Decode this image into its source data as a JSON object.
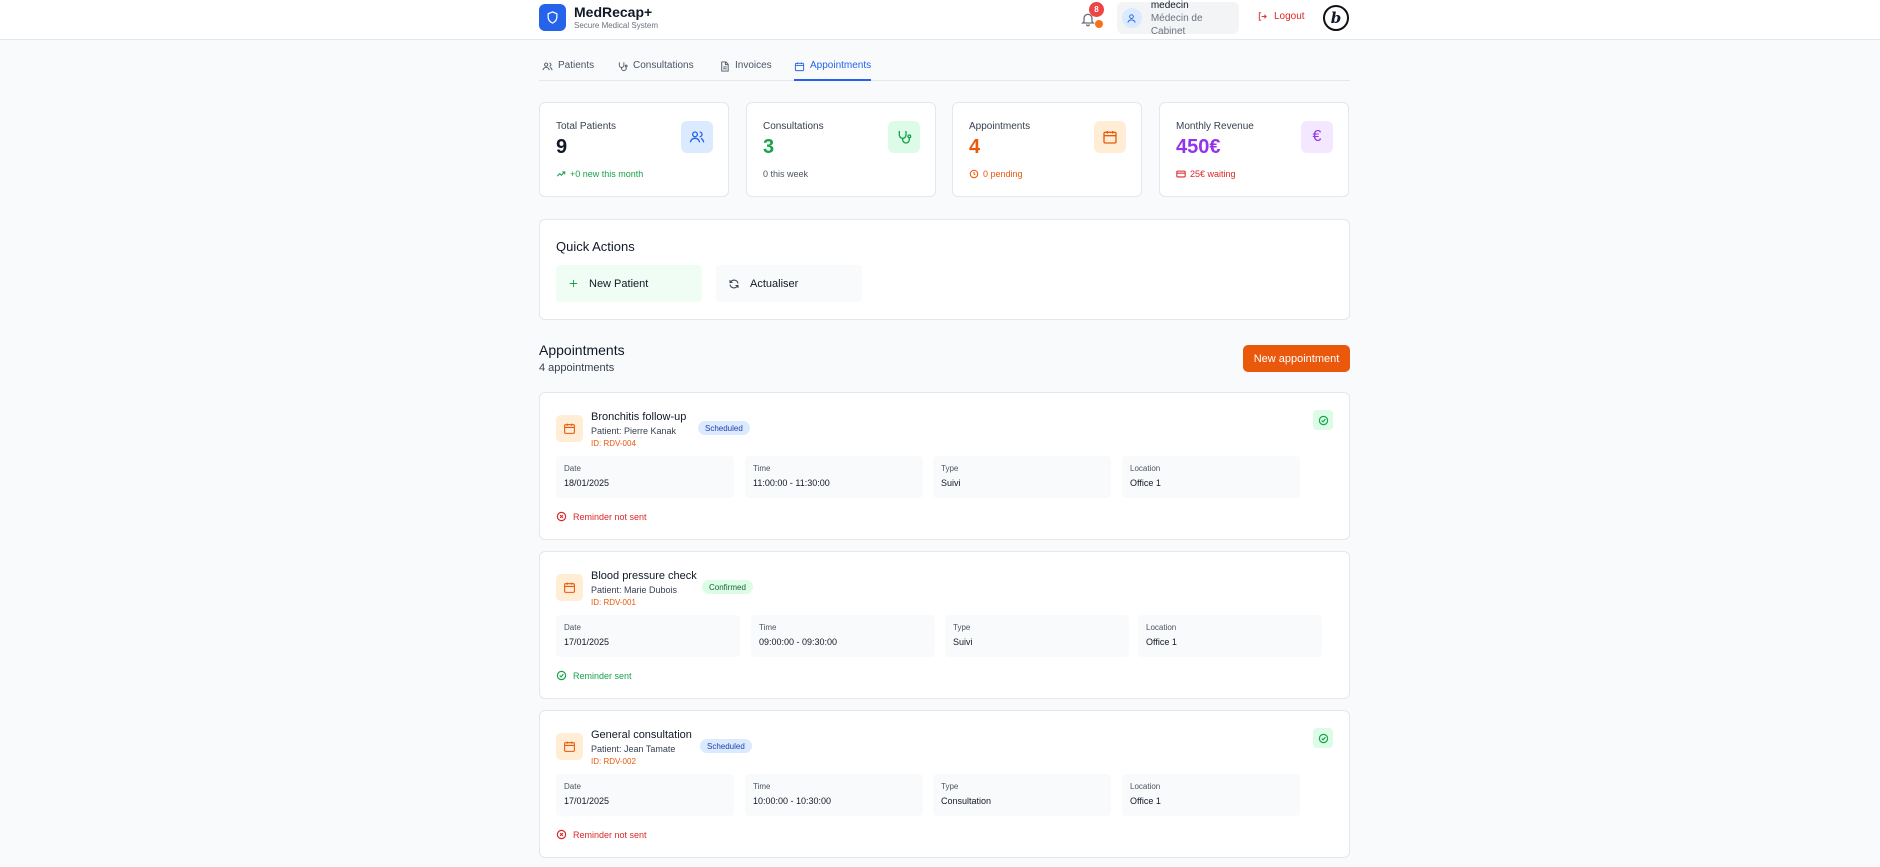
{
  "app": {
    "name": "MedRecap+",
    "tagline": "Secure Medical System"
  },
  "header": {
    "notifications_count": "8",
    "user": {
      "name": "medecin",
      "role": "Médecin de Cabinet"
    },
    "logout_label": "Logout"
  },
  "tabs": [
    {
      "label": "Patients",
      "icon": "users-icon",
      "active": false
    },
    {
      "label": "Consultations",
      "icon": "stethoscope-icon",
      "active": false
    },
    {
      "label": "Invoices",
      "icon": "file-icon",
      "active": false
    },
    {
      "label": "Appointments",
      "icon": "calendar-icon",
      "active": true
    }
  ],
  "stats": [
    {
      "label": "Total Patients",
      "value": "9",
      "sub": "+0 new this month",
      "color": "#111827",
      "sub_color": "#16a34a",
      "icon": "users-icon"
    },
    {
      "label": "Consultations",
      "value": "3",
      "sub": "0 this week",
      "color": "#16a34a",
      "sub_color": "#4b5563",
      "icon": "stethoscope-icon"
    },
    {
      "label": "Appointments",
      "value": "4",
      "sub": "0 pending",
      "color": "#ea580c",
      "sub_color": "#ea580c",
      "icon": "calendar-icon"
    },
    {
      "label": "Monthly Revenue",
      "value": "450€",
      "sub": "25€ waiting",
      "color": "#9333ea",
      "sub_color": "#dc2626",
      "icon": "euro-icon"
    }
  ],
  "quick_actions": {
    "title": "Quick Actions",
    "new_patient": "New Patient",
    "refresh": "Actualiser"
  },
  "appointments": {
    "title": "Appointments",
    "count_label": "4 appointments",
    "new_button": "New appointment",
    "field_labels": {
      "date": "Date",
      "time": "Time",
      "type": "Type",
      "location": "Location"
    },
    "items": [
      {
        "title": "Bronchitis follow-up",
        "patient": "Patient: Pierre Kanak",
        "id": "ID: RDV-004",
        "status": "Scheduled",
        "date": "18/01/2025",
        "time": "11:00:00 - 11:30:00",
        "type": "Suivi",
        "location": "Office 1",
        "reminder": "Reminder not sent"
      },
      {
        "title": "Blood pressure check",
        "patient": "Patient: Marie Dubois",
        "id": "ID: RDV-001",
        "status": "Confirmed",
        "date": "17/01/2025",
        "time": "09:00:00 - 09:30:00",
        "type": "Suivi",
        "location": "Office 1",
        "reminder": "Reminder sent"
      },
      {
        "title": "General consultation",
        "patient": "Patient: Jean Tamate",
        "id": "ID: RDV-002",
        "status": "Scheduled",
        "date": "17/01/2025",
        "time": "10:00:00 - 10:30:00",
        "type": "Consultation",
        "location": "Office 1",
        "reminder": "Reminder not sent"
      }
    ]
  }
}
